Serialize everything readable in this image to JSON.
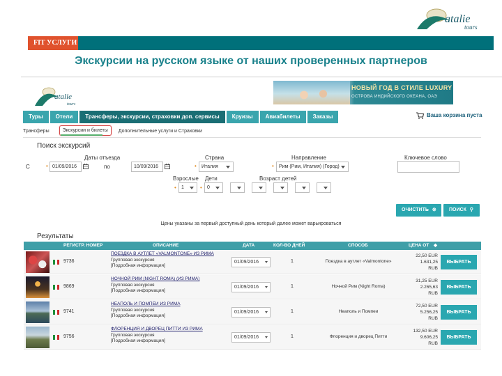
{
  "slide": {
    "logo_text": "Natalie tours",
    "bar_label": "FIT УСЛУГИ",
    "title": "Экскурсии на русском языке от наших проверенных партнеров"
  },
  "site": {
    "logo_text": "Natalie tours",
    "banner": {
      "line1": "НОВЫЙ ГОД В СТИЛЕ LUXURY",
      "line2": "ОСТРОВА ИНДИЙСКОГО ОКЕАНА, ОАЭ"
    },
    "nav": [
      "Туры",
      "Отели",
      "Трансферы, экскурсии, страховки доп. сервисы",
      "Круизы",
      "Авиабилеты",
      "Заказы"
    ],
    "cart": "Ваша корзина пуста",
    "subnav": {
      "transfers": "Трансферы",
      "excursions": "Экскурсии и билеты",
      "extra": "Дополнительные услуги и Страховки"
    }
  },
  "search": {
    "title": "Поиск экскурсий",
    "dates_label": "Даты отъезда",
    "from_label": "С",
    "to_label": "по",
    "date_from": "01/09/2016",
    "date_to": "10/09/2016",
    "country_label": "Страна",
    "country": "Италия",
    "direction_label": "Направление",
    "direction": "Рим (Рим, Италия) (Город)",
    "keyword_label": "Ключевое слово",
    "keyword": "",
    "adults_label": "Взрослые",
    "adults": "1",
    "children_label": "Дети",
    "children": "0",
    "child_age_label": "Возраст детей",
    "clear_button": "ОЧИСТИТЬ",
    "search_button": "ПОИСК",
    "note": "Цены указаны за первый доступный день который далее может варьироваться"
  },
  "results": {
    "title": "Результаты",
    "headers": {
      "reg": "РЕГИСТР. НОМЕР",
      "desc": "ОПИСАНИЕ",
      "date": "ДАТА",
      "days": "КОЛ-ВО ДНЕЙ",
      "way": "СПОСОБ",
      "price": "ЦЕНА ОТ"
    },
    "rows": [
      {
        "reg": "9736",
        "title": "ПОЕЗДКА В АУТЛЕТ «VALMONTONE» ИЗ РИМА",
        "type": "Групповая экскурсия",
        "more": "[Подробная информация]",
        "date": "01/09/2016",
        "days": "1",
        "way": "Поездка в аутлет «Valmontone»",
        "eur": "22,50 EUR",
        "rub": "1.631,25",
        "rub_unit": "RUB",
        "button": "ВЫБРАТЬ"
      },
      {
        "reg": "9869",
        "title": "НОЧНОЙ РИМ (NIGHT ROMA) (ИЗ РИМА)",
        "type": "Групповая экскурсия",
        "more": "[Подробная информация]",
        "date": "01/09/2016",
        "days": "1",
        "way": "Ночной Рим (Night Roma)",
        "eur": "31,25 EUR",
        "rub": "2.265,63",
        "rub_unit": "RUB",
        "button": "ВЫБРАТЬ"
      },
      {
        "reg": "9741",
        "title": "НЕАПОЛЬ И ПОМПЕИ ИЗ РИМА",
        "type": "Групповая экскурсия",
        "more": "[Подробная информация]",
        "date": "01/09/2016",
        "days": "1",
        "way": "Неаполь и Помпеи",
        "eur": "72,50 EUR",
        "rub": "5.256,25",
        "rub_unit": "RUB",
        "button": "ВЫБРАТЬ"
      },
      {
        "reg": "9756",
        "title": "ФЛОРЕНЦИЯ И ДВОРЕЦ ПИТТИ ИЗ РИМА",
        "type": "Групповая экскурсия",
        "more": "[Подробная информация]",
        "date": "01/09/2016",
        "days": "1",
        "way": "Флоренция и дворец Питти",
        "eur": "132,50 EUR",
        "rub": "9.606,25",
        "rub_unit": "RUB",
        "button": "ВЫБРАТЬ"
      }
    ]
  }
}
